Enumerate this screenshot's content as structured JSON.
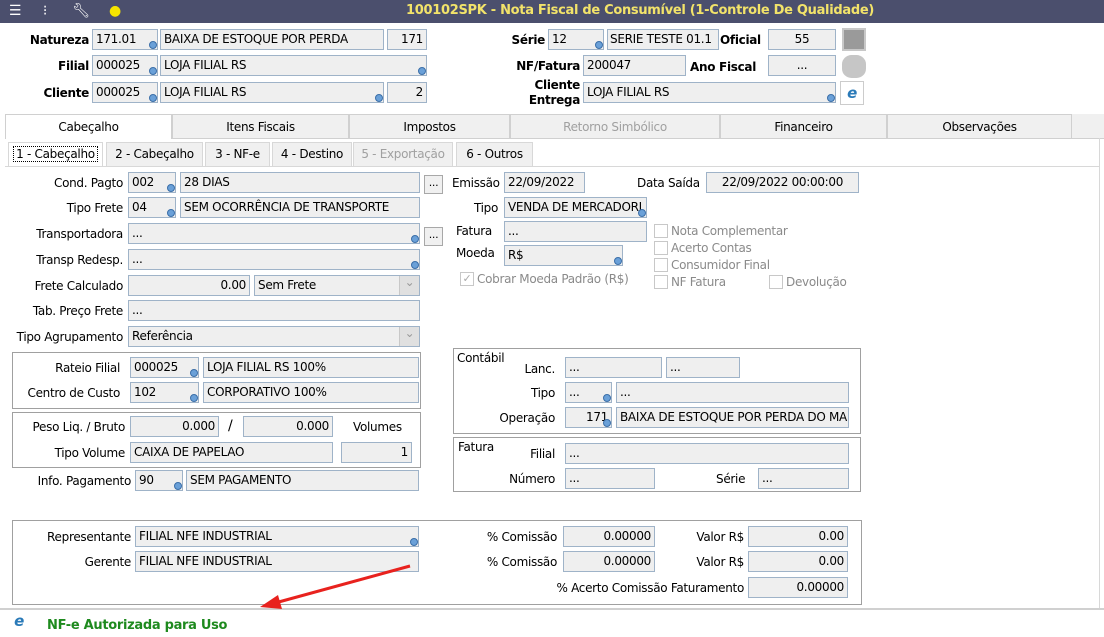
{
  "window": {
    "title": "100102SPK - Nota Fiscal de Consumível (1-Controle De Qualidade)",
    "toolbar_icons": [
      "menu-icon",
      "traffic-light-icon",
      "wrench-icon",
      "lightbulb-icon"
    ]
  },
  "header": {
    "natureza": {
      "label": "Natureza",
      "code": "171.01",
      "desc": "BAIXA DE ESTOQUE POR PERDA",
      "num": "171"
    },
    "filial": {
      "label": "Filial",
      "code": "000025",
      "desc": "LOJA FILIAL RS"
    },
    "cliente": {
      "label": "Cliente",
      "code": "000025",
      "desc": "LOJA FILIAL RS",
      "num": "2"
    },
    "serie": {
      "label": "Série",
      "code": "12",
      "desc": "SERIE TESTE 01.1"
    },
    "oficial": {
      "label": "Oficial",
      "value": "55"
    },
    "nf_fatura": {
      "label": "NF/Fatura",
      "value": "200047"
    },
    "ano_fiscal": {
      "label": "Ano Fiscal",
      "value": "..."
    },
    "cliente_entrega": {
      "label1": "Cliente",
      "label2": "Entrega",
      "value": "LOJA FILIAL RS"
    }
  },
  "tabs": [
    "Cabeçalho",
    "Itens Fiscais",
    "Impostos",
    "Retorno Simbólico",
    "Financeiro",
    "Observações"
  ],
  "subtabs": [
    "1 - Cabeçalho",
    "2 - Cabeçalho",
    "3 - NF-e",
    "4 - Destino",
    "5 - Exportação",
    "6 - Outros"
  ],
  "form": {
    "cond_pagto": {
      "label": "Cond. Pagto",
      "code": "002",
      "desc": "28 DIAS"
    },
    "tipo_frete": {
      "label": "Tipo Frete",
      "code": "04",
      "desc": "SEM OCORRÊNCIA DE TRANSPORTE"
    },
    "transportadora": {
      "label": "Transportadora",
      "value": "..."
    },
    "transp_redesp": {
      "label": "Transp Redesp.",
      "value": "..."
    },
    "frete_calculado": {
      "label": "Frete Calculado",
      "value": "0.00",
      "option": "Sem Frete"
    },
    "tab_preco_frete": {
      "label": "Tab. Preço Frete",
      "value": "..."
    },
    "tipo_agrupamento": {
      "label": "Tipo Agrupamento",
      "value": "Referência"
    },
    "rateio_filial": {
      "label": "Rateio Filial",
      "code": "000025",
      "desc": "LOJA FILIAL RS 100%"
    },
    "centro_custo": {
      "label": "Centro de Custo",
      "code": "102",
      "desc": "CORPORATIVO 100%"
    },
    "peso": {
      "label": "Peso Liq. / Bruto",
      "liq": "0.000",
      "sep": "/",
      "bruto": "0.000",
      "volumes_label": "Volumes"
    },
    "tipo_volume": {
      "label": "Tipo Volume",
      "value": "CAIXA DE PAPELAO",
      "volumes": "1"
    },
    "info_pagamento": {
      "label": "Info. Pagamento",
      "code": "90",
      "desc": "SEM PAGAMENTO"
    },
    "ellipsis": "...",
    "emissao": {
      "label": "Emissão",
      "value": "22/09/2022"
    },
    "data_saida": {
      "label": "Data Saída",
      "value": "22/09/2022 00:00:00"
    },
    "tipo": {
      "label": "Tipo",
      "value": "VENDA DE MERCADORI"
    },
    "fatura": {
      "label": "Fatura",
      "value": "..."
    },
    "moeda": {
      "label": "Moeda",
      "value": "R$"
    },
    "cobrar_moeda": {
      "label": "Cobrar Moeda Padrão (R$)",
      "checked": true
    },
    "checks": {
      "nota_complementar": "Nota Complementar",
      "acerto_contas": "Acerto Contas",
      "consumidor_final": "Consumidor Final",
      "nf_fatura": "NF Fatura",
      "devolucao": "Devolução"
    },
    "contabil": {
      "title": "Contábil",
      "lanc_label": "Lanc.",
      "lanc1": "...",
      "lanc2": "...",
      "tipo_label": "Tipo",
      "tipo1": "...",
      "tipo2": "...",
      "operacao_label": "Operação",
      "operacao_code": "171",
      "operacao_desc": "BAIXA DE ESTOQUE POR PERDA DO MA"
    },
    "fatura_box": {
      "title": "Fatura",
      "filial_label": "Filial",
      "filial": "...",
      "numero_label": "Número",
      "numero": "...",
      "serie_label": "Série",
      "serie": "..."
    },
    "representante": {
      "label": "Representante",
      "value": "FILIAL NFE INDUSTRIAL",
      "comissao_label": "% Comissão",
      "comissao": "0.00000",
      "valor_label": "Valor R$",
      "valor": "0.00"
    },
    "gerente": {
      "label": "Gerente",
      "value": "FILIAL NFE INDUSTRIAL",
      "comissao_label": "% Comissão",
      "comissao": "0.00000",
      "valor_label": "Valor R$",
      "valor": "0.00"
    },
    "acerto": {
      "label": "% Acerto Comissão Faturamento",
      "value": "0.00000"
    }
  },
  "status": {
    "text": "NF-e Autorizada para Uso",
    "color": "#1e8a1e"
  }
}
